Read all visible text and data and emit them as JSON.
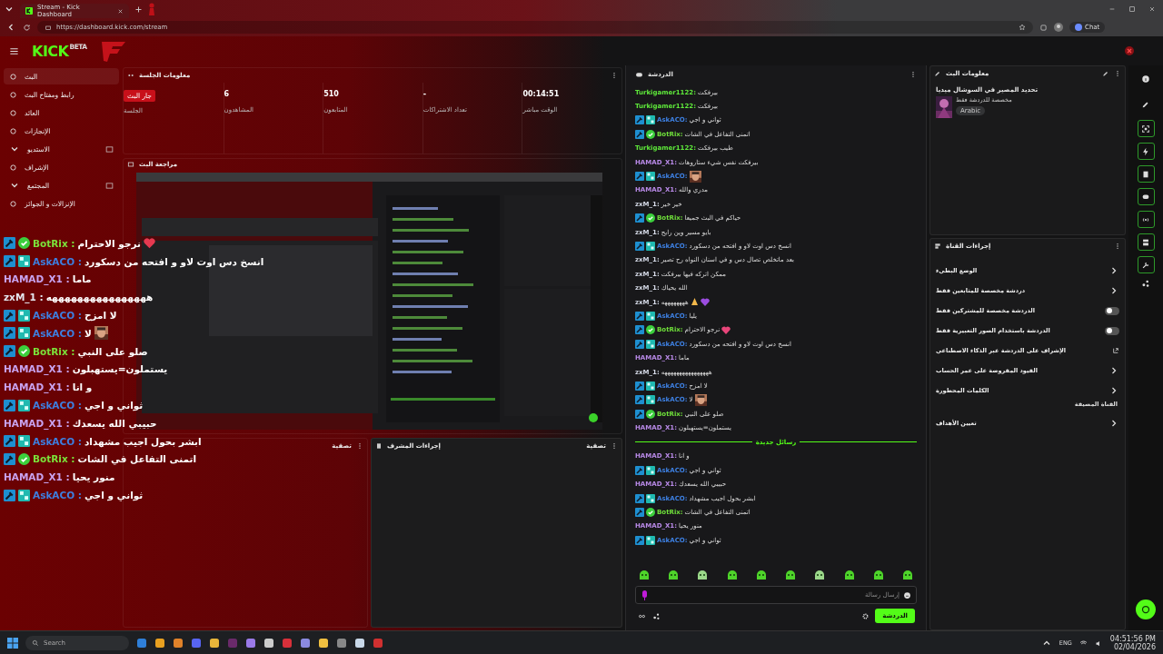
{
  "browser": {
    "tab_title": "Stream - Kick Dashboard",
    "url": "https://dashboard.kick.com/stream",
    "chat_button": "Chat"
  },
  "header": {
    "logo": "KICK",
    "logo_badge": "BETA"
  },
  "sidebar": {
    "items": [
      {
        "label": "البث",
        "kind": "link",
        "selected": true
      },
      {
        "label": "رابط ومفتاح البث",
        "kind": "link",
        "selected": false
      },
      {
        "label": "العائد",
        "kind": "link",
        "selected": false
      },
      {
        "label": "الإنجازات",
        "kind": "link",
        "selected": false
      },
      {
        "label": "الاستديو",
        "kind": "group",
        "selected": false,
        "expanded": false
      },
      {
        "label": "الإشراف",
        "kind": "link",
        "selected": false
      },
      {
        "label": "المجتمع",
        "kind": "group",
        "selected": false,
        "expanded": false
      },
      {
        "label": "الإنزالات و الجوائز",
        "kind": "link",
        "selected": false
      }
    ]
  },
  "session": {
    "title": "معلومات الجلسة",
    "stats": [
      {
        "value": "00:14:51",
        "label": "الوقت مباشر"
      },
      {
        "value": "-",
        "label": "تعداد الاشتراكات"
      },
      {
        "value": "510",
        "label": "المتابعون"
      },
      {
        "value": "6",
        "label": "المشاهدون"
      },
      {
        "badge": "جار البث",
        "label": "الجلسة"
      }
    ]
  },
  "preview": {
    "title": "مراجعة البث"
  },
  "bottom_panels": [
    {
      "title": "إجراءات المشرف",
      "filter": "تصفية"
    },
    {
      "filter": "تصفية"
    }
  ],
  "overlay_chat": [
    {
      "user": "BotRix :",
      "color": "#7be33a",
      "mod": true,
      "verified": true,
      "text": "نرجو الاحترام",
      "emojis": [
        {
          "kind": "heart",
          "color": "#e53950"
        }
      ]
    },
    {
      "user": "AskACO :",
      "color": "#3d7fe0",
      "mod": true,
      "sub": true,
      "text": "انسخ دس اوت لاو و افتحه من دسكورد"
    },
    {
      "user": "HAMAD_X1 :",
      "color": "#c9a3f0",
      "text": "ماما"
    },
    {
      "user": "zxM_1 :",
      "color": "#e4e6ee",
      "text": "ههههههههههههههههه"
    },
    {
      "user": "AskACO :",
      "color": "#3d7fe0",
      "mod": true,
      "sub": true,
      "text": "لا امزح"
    },
    {
      "user": "AskACO :",
      "color": "#3d7fe0",
      "mod": true,
      "sub": true,
      "text": "لا",
      "emote": true
    },
    {
      "user": "BotRix :",
      "color": "#7be33a",
      "mod": true,
      "verified": true,
      "text": "صلو على النبي"
    },
    {
      "user": "HAMAD_X1 :",
      "color": "#c9a3f0",
      "text": "يستملون=يستهبلون"
    },
    {
      "user": "HAMAD_X1 :",
      "color": "#c9a3f0",
      "text": "و انا"
    },
    {
      "user": "AskACO :",
      "color": "#3d7fe0",
      "mod": true,
      "sub": true,
      "text": "ثواني و اجي"
    },
    {
      "user": "HAMAD_X1 :",
      "color": "#c9a3f0",
      "text": "حبيبي الله يسعدك"
    },
    {
      "user": "AskACO :",
      "color": "#3d7fe0",
      "mod": true,
      "sub": true,
      "text": "ابشر بحول اجيب مشهداد"
    },
    {
      "user": "BotRix :",
      "color": "#7be33a",
      "mod": true,
      "verified": true,
      "text": "اتمنى التفاعل في الشات"
    },
    {
      "user": "HAMAD_X1 :",
      "color": "#c9a3f0",
      "text": "منور يحيا"
    },
    {
      "user": "AskACO :",
      "color": "#3d7fe0",
      "mod": true,
      "sub": true,
      "text": "ثواني و اجي"
    }
  ],
  "chat": {
    "title": "الدردشة",
    "messages": [
      {
        "user": "Turkigamer1122:",
        "color": "#5ee83a",
        "text": "بيرفكت"
      },
      {
        "user": "Turkigamer1122:",
        "color": "#5ee83a",
        "text": "بيرفكت"
      },
      {
        "user": "AskACO:",
        "color": "#3d7fe0",
        "mod": true,
        "sub": true,
        "text": "ثواني و اجي"
      },
      {
        "user": "BotRix:",
        "color": "#6fe03a",
        "mod": true,
        "verified": true,
        "text": "اتمنى التفاعل في الشات"
      },
      {
        "user": "Turkigamer1122:",
        "color": "#5ee83a",
        "text": "طيب بيرفكت"
      },
      {
        "user": "HAMAD_X1:",
        "color": "#b98ae8",
        "text": "بيرفكت نفس شيء ستاروهات"
      },
      {
        "user": "AskACO:",
        "color": "#3d7fe0",
        "mod": true,
        "sub": true,
        "emote": true
      },
      {
        "user": "HAMAD_X1:",
        "color": "#b98ae8",
        "text": "مدري والله"
      },
      {
        "user": "zxM_1:",
        "color": "#d6dbe8",
        "text": "خير خير"
      },
      {
        "user": "BotRix:",
        "color": "#6fe03a",
        "mod": true,
        "verified": true,
        "text": "حياكم في البث جميعا"
      },
      {
        "user": "zxM_1:",
        "color": "#d6dbe8",
        "text": "بايو مسير وين رايح"
      },
      {
        "user": "AskACO:",
        "color": "#3d7fe0",
        "mod": true,
        "sub": true,
        "text": "انسخ دس اوت لاو و افتحه من دسكورد"
      },
      {
        "user": "zxM_1:",
        "color": "#d6dbe8",
        "text": "بعد ماتخلص تصال دس و في اسنان النواه رح تصير"
      },
      {
        "user": "zxM_1:",
        "color": "#d6dbe8",
        "text": "ممكن اتركه فيها بيرفكت"
      },
      {
        "user": "zxM_1:",
        "color": "#d6dbe8",
        "text": "الله يحياك"
      },
      {
        "user": "zxM_1:",
        "color": "#d6dbe8",
        "text": "ههههههههه",
        "emojis": [
          {
            "kind": "hands",
            "color": "#f2b84b"
          },
          {
            "kind": "heart",
            "color": "#9b4de0"
          }
        ]
      },
      {
        "user": "AskACO:",
        "color": "#3d7fe0",
        "mod": true,
        "sub": true,
        "text": "يليا"
      },
      {
        "user": "BotRix:",
        "color": "#6fe03a",
        "mod": true,
        "verified": true,
        "text": "نرجو الاحترام",
        "emojis": [
          {
            "kind": "heart",
            "color": "#e8457a"
          }
        ]
      },
      {
        "user": "AskACO:",
        "color": "#3d7fe0",
        "mod": true,
        "sub": true,
        "text": "انسخ دس اوت لاو و افتحه من دسكورد"
      },
      {
        "user": "HAMAD_X1:",
        "color": "#b98ae8",
        "text": "ماما"
      },
      {
        "user": "zxM_1:",
        "color": "#d6dbe8",
        "text": "ههههههههههههههههه"
      },
      {
        "user": "AskACO:",
        "color": "#3d7fe0",
        "mod": true,
        "sub": true,
        "text": "لا امزح"
      },
      {
        "user": "AskACO:",
        "color": "#3d7fe0",
        "mod": true,
        "sub": true,
        "text": "لا",
        "emote": true
      },
      {
        "user": "BotRix:",
        "color": "#6fe03a",
        "mod": true,
        "verified": true,
        "text": "صلو على النبي"
      },
      {
        "user": "HAMAD_X1:",
        "color": "#b98ae8",
        "text": "يستملون=يستهبلون"
      },
      {
        "kind": "divider",
        "text": "رسائل جديدة"
      },
      {
        "user": "HAMAD_X1:",
        "color": "#b98ae8",
        "text": "و انا"
      },
      {
        "user": "AskACO:",
        "color": "#3d7fe0",
        "mod": true,
        "sub": true,
        "text": "ثواني و اجي"
      },
      {
        "user": "HAMAD_X1:",
        "color": "#b98ae8",
        "text": "حبيبي الله يسعدك"
      },
      {
        "user": "AskACO:",
        "color": "#3d7fe0",
        "mod": true,
        "sub": true,
        "text": "ابشر بحول اجيب مشهداد"
      },
      {
        "user": "BotRix:",
        "color": "#6fe03a",
        "mod": true,
        "verified": true,
        "text": "اتمنى التفاعل في الشات"
      },
      {
        "user": "HAMAD_X1:",
        "color": "#b98ae8",
        "text": "منور يحيا"
      },
      {
        "user": "AskACO:",
        "color": "#3d7fe0",
        "mod": true,
        "sub": true,
        "text": "ثواني و اجي"
      }
    ],
    "placeholder": "إرسال رسالة",
    "send_button": "الدردشة"
  },
  "stream_info": {
    "title": "معلومات البث",
    "stream_title": "تحديد المصير في السوشال ميديا",
    "category": "مخصصة للدردشة فقط",
    "tag": "Arabic"
  },
  "channel_actions": {
    "title": "إجراءات القناة",
    "items": [
      {
        "kind": "nav",
        "label": "الوضع البطيء"
      },
      {
        "kind": "nav",
        "label": "دردشة مخصصة للمتابعين فقط"
      },
      {
        "kind": "toggle",
        "label": "الدردشة مخصصة للمشتركين فقط",
        "on": false
      },
      {
        "kind": "toggle",
        "label": "الدردشة باستخدام الصور التعبيرية فقط",
        "on": false
      },
      {
        "kind": "external",
        "label": "الإشراف على الدردشة عبر الذكاء الاصطناعي"
      },
      {
        "kind": "nav",
        "label": "القيود المفروضة على عمر الحساب"
      },
      {
        "kind": "nav",
        "label": "الكلمات المحظورة"
      },
      {
        "kind": "heading",
        "label": "القناة المضيفة"
      },
      {
        "kind": "nav",
        "label": "تعيين الأهداف"
      }
    ]
  },
  "taskbar": {
    "search": "Search",
    "language": "ENG",
    "time": "04:51:56 PM",
    "date": "02/04/2026"
  }
}
